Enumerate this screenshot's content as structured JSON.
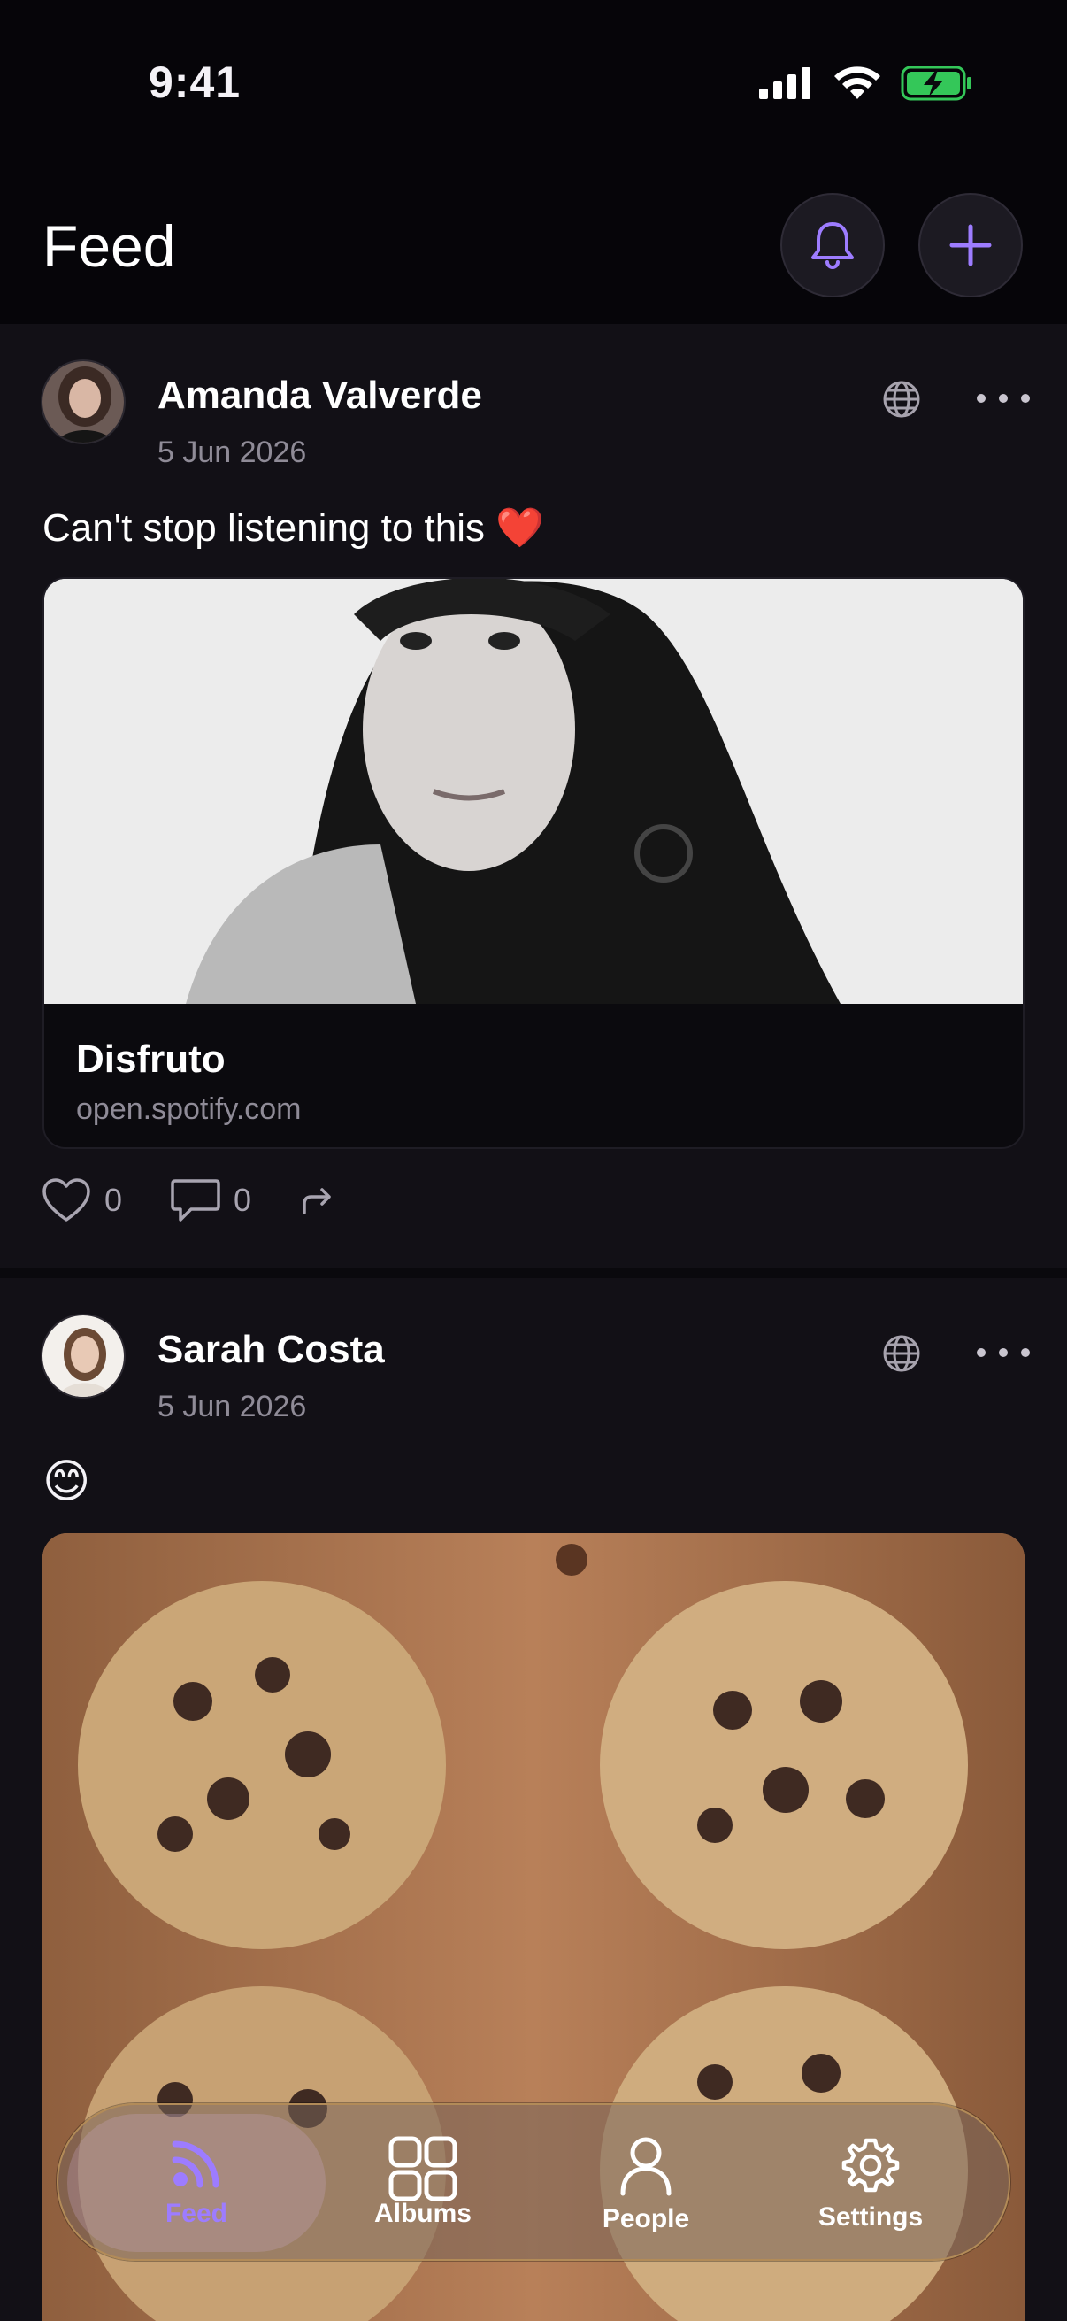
{
  "status_bar": {
    "time": "9:41"
  },
  "header": {
    "title": "Feed"
  },
  "posts": [
    {
      "author": "Amanda Valverde",
      "date": "5 Jun 2026",
      "text": "Can't stop listening to this ❤️",
      "link_card": {
        "title": "Disfruto",
        "domain": "open.spotify.com"
      },
      "likes": "0",
      "comments": "0"
    },
    {
      "author": "Sarah Costa",
      "date": "5 Jun 2026",
      "text": "😊"
    }
  ],
  "tabs": [
    {
      "label": "Feed",
      "active": true
    },
    {
      "label": "Albums",
      "active": false
    },
    {
      "label": "People",
      "active": false
    },
    {
      "label": "Settings",
      "active": false
    }
  ],
  "colors": {
    "accent": "#9d7cff",
    "background": "#0a090d",
    "card": "#121016",
    "battery": "#34c759"
  }
}
